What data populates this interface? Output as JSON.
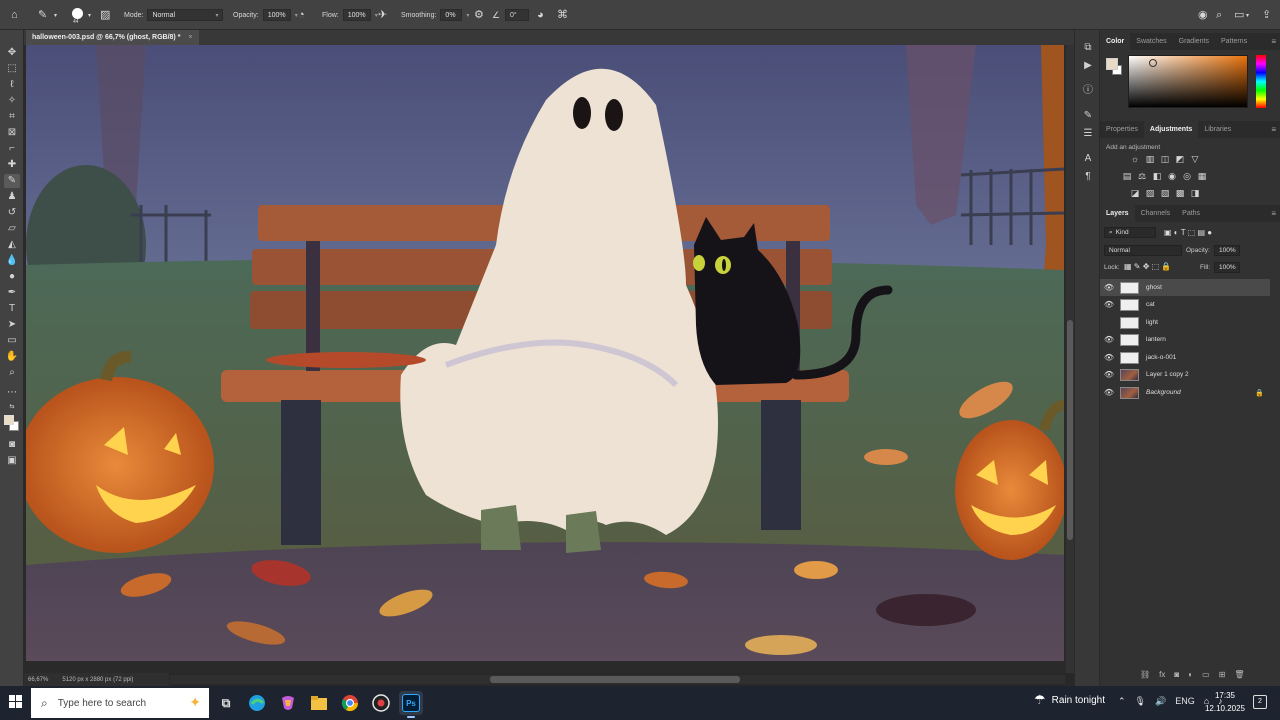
{
  "options_bar": {
    "brush_size": "44",
    "mode_label": "Mode:",
    "mode_value": "Normal",
    "opacity_label": "Opacity:",
    "opacity_value": "100%",
    "flow_label": "Flow:",
    "flow_value": "100%",
    "smoothing_label": "Smoothing:",
    "smoothing_value": "0%",
    "angle_value": "0°"
  },
  "document_tab": {
    "title": "halloween-003.psd @ 66,7% (ghost, RGB/8) *",
    "close": "×"
  },
  "status_bar": {
    "zoom": "66,67%",
    "doc_info": "5120 px x 2880 px (72 ppi)"
  },
  "color_panel": {
    "tabs": [
      "Color",
      "Swatches",
      "Gradients",
      "Patterns"
    ],
    "foreground": "#e8dac4",
    "background": "#ffffff",
    "hue": "#e8720c"
  },
  "adjustments_panel": {
    "tabs": [
      "Properties",
      "Adjustments",
      "Libraries"
    ],
    "title": "Add an adjustment"
  },
  "layers_panel": {
    "tabs": [
      "Layers",
      "Channels",
      "Paths"
    ],
    "filter_kind": "Kind",
    "blend_mode": "Normal",
    "opacity_label": "Opacity:",
    "opacity_value": "100%",
    "lock_label": "Lock:",
    "fill_label": "Fill:",
    "fill_value": "100%",
    "layers": [
      {
        "name": "ghost",
        "visible": true,
        "selected": true
      },
      {
        "name": "cat",
        "visible": true,
        "selected": false
      },
      {
        "name": "light",
        "visible": false,
        "selected": false
      },
      {
        "name": "lantern",
        "visible": true,
        "selected": false
      },
      {
        "name": "jack-o-001",
        "visible": true,
        "selected": false
      },
      {
        "name": "Layer 1 copy 2",
        "visible": true,
        "selected": false
      },
      {
        "name": "Background",
        "visible": true,
        "selected": false,
        "locked": true
      }
    ]
  },
  "taskbar": {
    "search_placeholder": "Type here to search",
    "weather": "Rain tonight",
    "language": "ENG",
    "time": "17:35",
    "date": "12.10.2025",
    "notifications": "2",
    "apps": [
      "Task View",
      "Edge",
      "Copilot",
      "File Explorer",
      "Chrome",
      "Chrome Canary",
      "Photoshop"
    ],
    "photoshop_label": "Ps"
  }
}
